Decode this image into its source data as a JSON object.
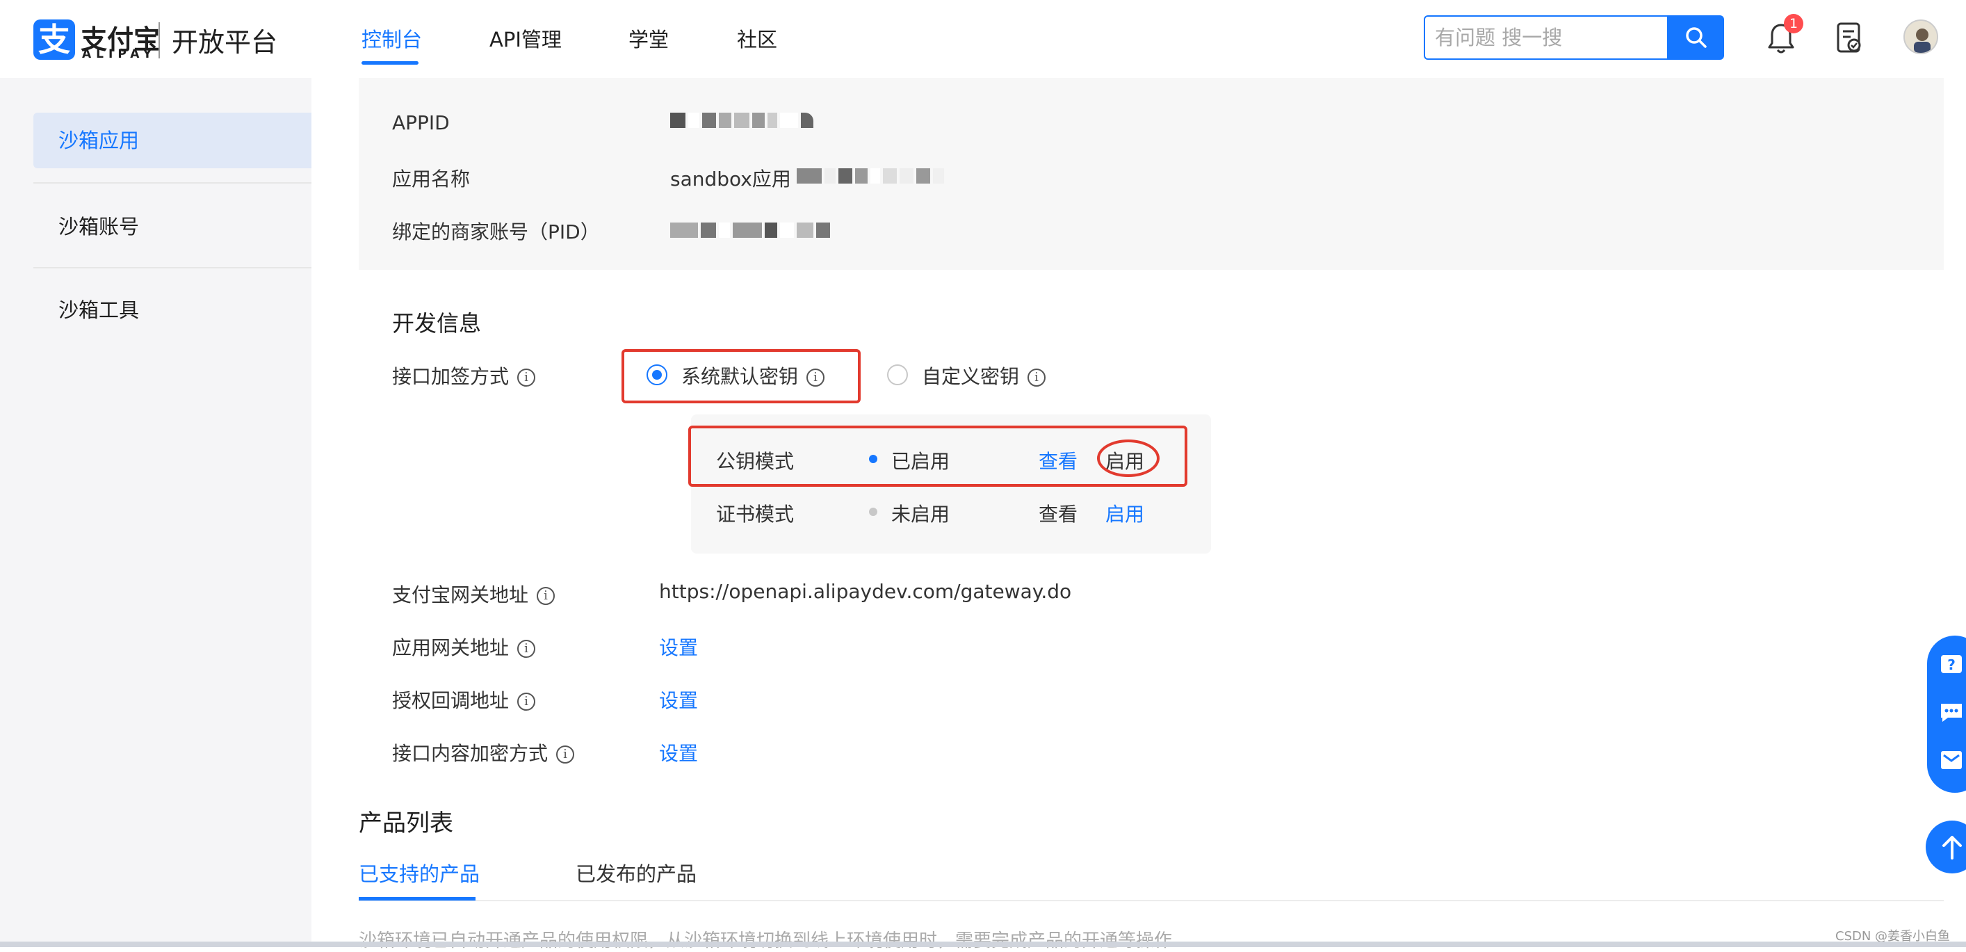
{
  "brand": {
    "logo_glyph": "支",
    "logo_cn": "支付宝",
    "logo_en": "ALIPAY",
    "platform": "开放平台",
    "accent": "#1677ff"
  },
  "nav": {
    "items": [
      {
        "label": "控制台",
        "active": true
      },
      {
        "label": "API管理"
      },
      {
        "label": "学堂"
      },
      {
        "label": "社区"
      }
    ]
  },
  "search": {
    "placeholder": "有问题 搜一搜"
  },
  "notifications": {
    "count": "1"
  },
  "sidebar": {
    "items": [
      {
        "label": "沙箱应用",
        "active": true
      },
      {
        "label": "沙箱账号"
      },
      {
        "label": "沙箱工具"
      }
    ]
  },
  "app_info": {
    "appid_label": "APPID",
    "name_label": "应用名称",
    "name_value": "sandbox应用",
    "pid_label": "绑定的商家账号（PID）"
  },
  "dev_info": {
    "title": "开发信息",
    "sign_label": "接口加签方式",
    "option_default": "系统默认密钥",
    "option_custom": "自定义密钥",
    "modes": [
      {
        "name": "公钥模式",
        "status": "已启用",
        "view": "查看",
        "enable": "启用",
        "status_color": "#1677ff"
      },
      {
        "name": "证书模式",
        "status": "未启用",
        "view": "查看",
        "enable": "启用",
        "status_color": "#c8c8c8"
      }
    ],
    "gateway_label": "支付宝网关地址",
    "gateway_value": "https://openapi.alipaydev.com/gateway.do",
    "app_gateway_label": "应用网关地址",
    "callback_label": "授权回调地址",
    "encrypt_label": "接口内容加密方式",
    "set_label": "设置",
    "highlight_color": "#e23a2e"
  },
  "products": {
    "title": "产品列表",
    "tabs": [
      {
        "label": "已支持的产品",
        "active": true
      },
      {
        "label": "已发布的产品"
      }
    ],
    "notice": "沙箱环境已自动开通产品的使用权限，从沙箱环境切换到线上环境使用时，需要完成产品的开通等操作"
  },
  "watermark": "CSDN @姜香小白鱼"
}
